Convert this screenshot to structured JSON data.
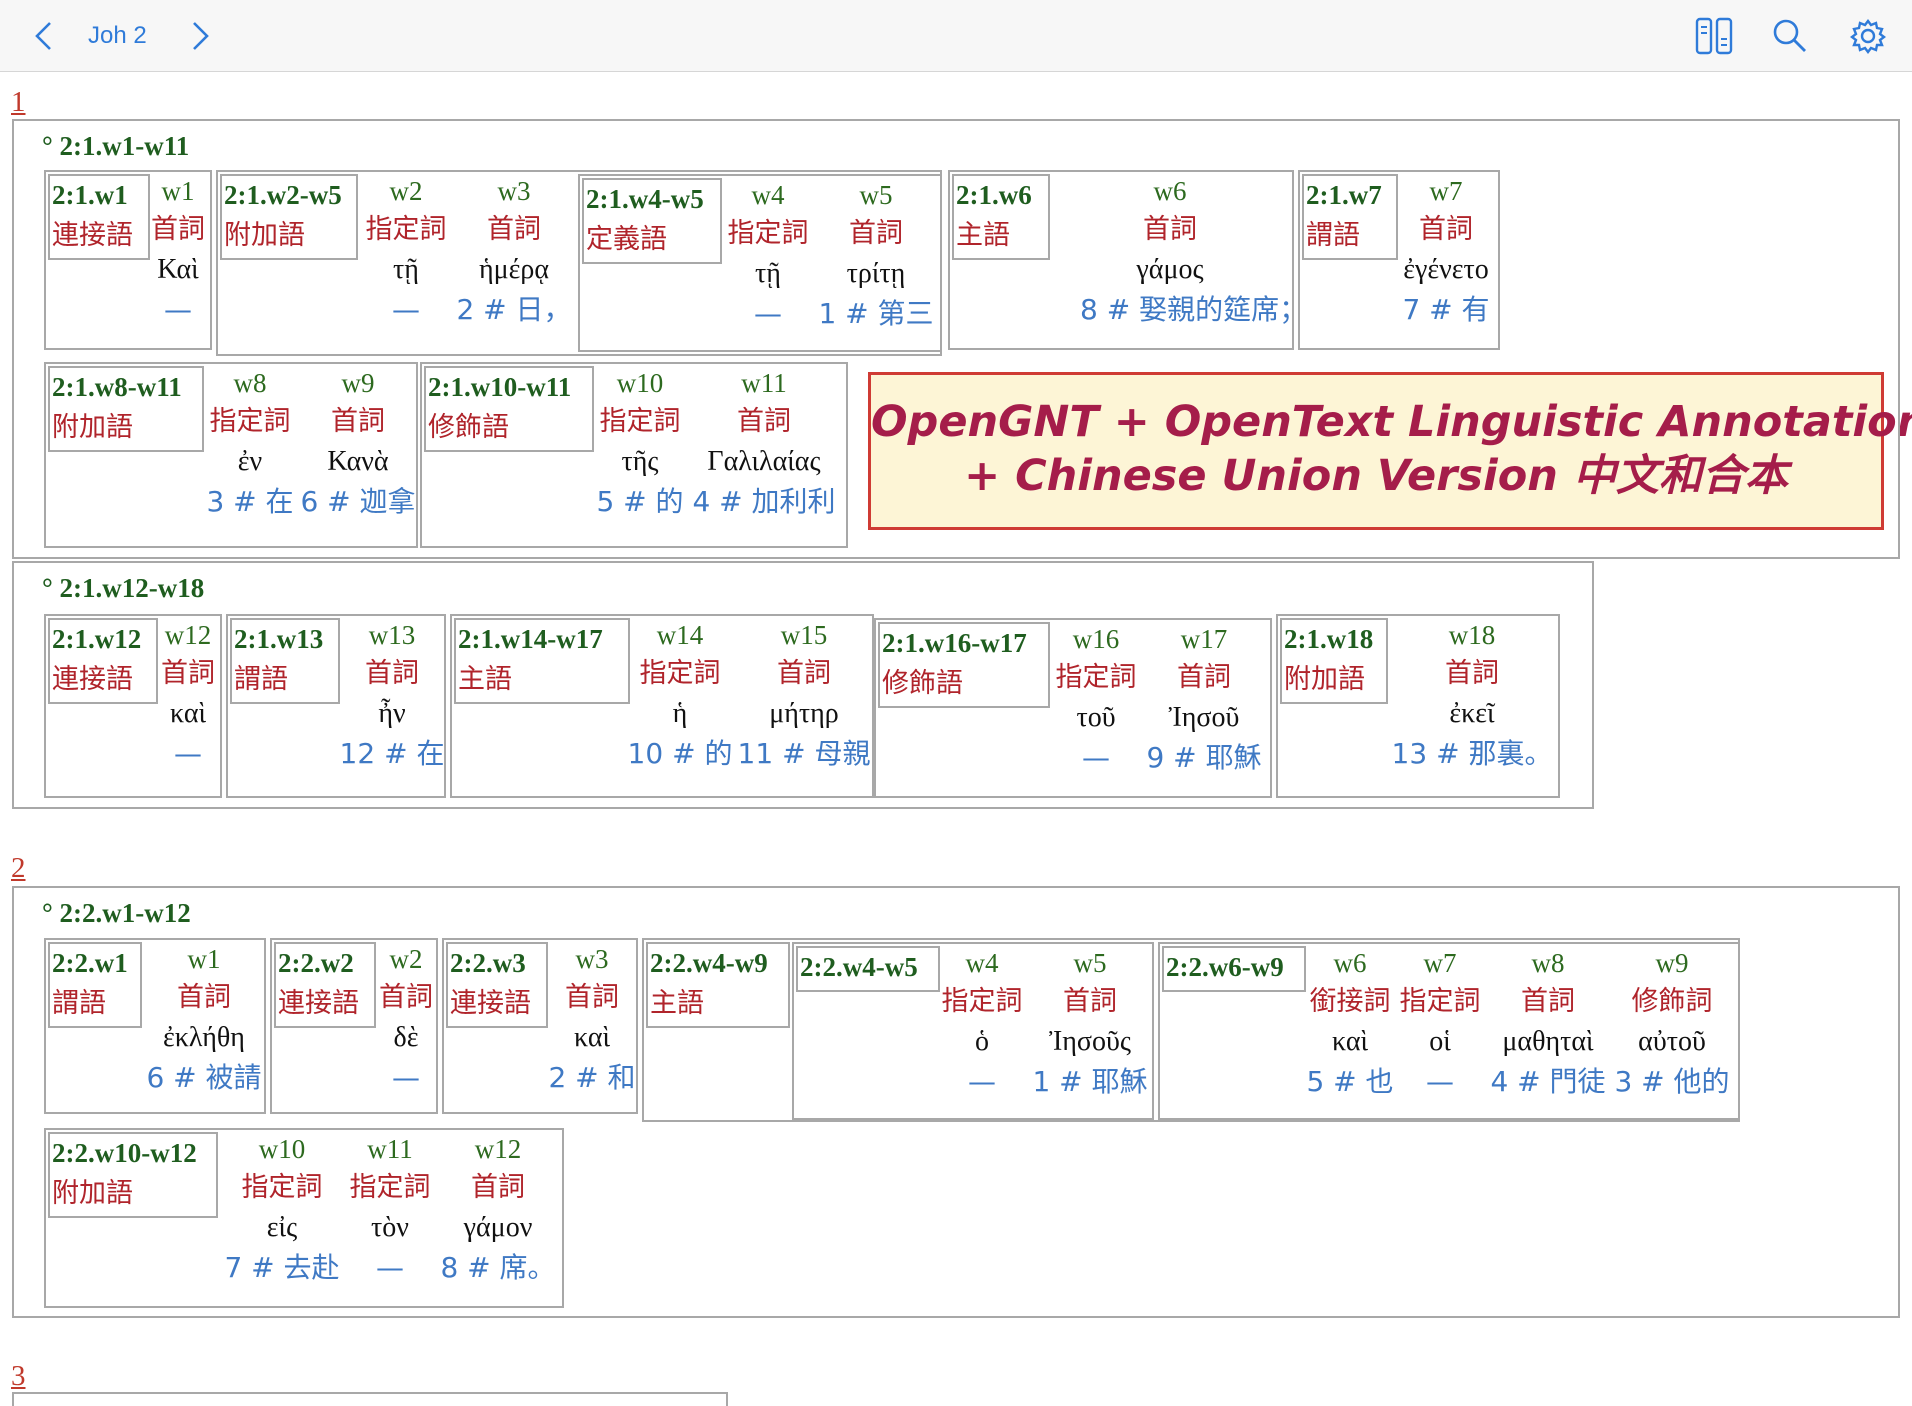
{
  "toolbar": {
    "book": "Joh 2",
    "icons": [
      "chevron-left-icon",
      "chevron-right-icon",
      "parallel-view-icon",
      "search-icon",
      "settings-gear-icon"
    ]
  },
  "banner": {
    "line1": "OpenGNT + OpenText Linguistic Annotations",
    "line2": "+ Chinese Union Version 中文和合本"
  },
  "verses": [
    {
      "number": "1"
    },
    {
      "number": "2"
    },
    {
      "number": "3"
    }
  ],
  "phrases": [
    {
      "label": "° 2:1.w1-w11"
    },
    {
      "label": "° 2:1.w12-w18"
    },
    {
      "label": "° 2:2.w1-w12"
    }
  ],
  "clauses": [
    {
      "label": "2:1.w1",
      "role": "連接語",
      "words": [
        {
          "id": "w1",
          "role": "首詞",
          "greek": "Καὶ",
          "cuv": "—"
        }
      ]
    },
    {
      "label": "2:1.w2-w5",
      "role": "附加語",
      "words": [
        {
          "id": "w2",
          "role": "指定詞",
          "greek": "τῇ",
          "cuv": "—"
        },
        {
          "id": "w3",
          "role": "首詞",
          "greek": "ἡμέρᾳ",
          "cuv": "2 # 日，"
        }
      ]
    },
    {
      "label": "2:1.w4-w5",
      "role": "定義語",
      "words": [
        {
          "id": "w4",
          "role": "指定詞",
          "greek": "τῇ",
          "cuv": "—"
        },
        {
          "id": "w5",
          "role": "首詞",
          "greek": "τρίτῃ",
          "cuv": "1 # 第三"
        }
      ]
    },
    {
      "label": "2:1.w6",
      "role": "主語",
      "words": [
        {
          "id": "w6",
          "role": "首詞",
          "greek": "γάμος",
          "cuv": "8 # 娶親的筵席；"
        }
      ]
    },
    {
      "label": "2:1.w7",
      "role": "謂語",
      "words": [
        {
          "id": "w7",
          "role": "首詞",
          "greek": "ἐγένετο",
          "cuv": "7 # 有"
        }
      ]
    },
    {
      "label": "2:1.w8-w11",
      "role": "附加語",
      "words": [
        {
          "id": "w8",
          "role": "指定詞",
          "greek": "ἐν",
          "cuv": "3 # 在"
        },
        {
          "id": "w9",
          "role": "首詞",
          "greek": "Κανὰ",
          "cuv": "6 # 迦拿"
        }
      ]
    },
    {
      "label": "2:1.w10-w11",
      "role": "修飾語",
      "words": [
        {
          "id": "w10",
          "role": "指定詞",
          "greek": "τῆς",
          "cuv": "5 # 的"
        },
        {
          "id": "w11",
          "role": "首詞",
          "greek": "Γαλιλαίας",
          "cuv": "4 # 加利利"
        }
      ]
    },
    {
      "label": "2:1.w12",
      "role": "連接語",
      "words": [
        {
          "id": "w12",
          "role": "首詞",
          "greek": "καὶ",
          "cuv": "—"
        }
      ]
    },
    {
      "label": "2:1.w13",
      "role": "謂語",
      "words": [
        {
          "id": "w13",
          "role": "首詞",
          "greek": "ἦν",
          "cuv": "12 # 在"
        }
      ]
    },
    {
      "label": "2:1.w14-w17",
      "role": "主語",
      "words": [
        {
          "id": "w14",
          "role": "指定詞",
          "greek": "ἡ",
          "cuv": "10 # 的"
        },
        {
          "id": "w15",
          "role": "首詞",
          "greek": "μήτηρ",
          "cuv": "11 # 母親"
        }
      ]
    },
    {
      "label": "2:1.w16-w17",
      "role": "修飾語",
      "words": [
        {
          "id": "w16",
          "role": "指定詞",
          "greek": "τοῦ",
          "cuv": "—"
        },
        {
          "id": "w17",
          "role": "首詞",
          "greek": "Ἰησοῦ",
          "cuv": "9 # 耶穌"
        }
      ]
    },
    {
      "label": "2:1.w18",
      "role": "附加語",
      "words": [
        {
          "id": "w18",
          "role": "首詞",
          "greek": "ἐκεῖ",
          "cuv": "13 # 那裏。"
        }
      ]
    },
    {
      "label": "2:2.w1",
      "role": "謂語",
      "words": [
        {
          "id": "w1",
          "role": "首詞",
          "greek": "ἐκλήθη",
          "cuv": "6 # 被請"
        }
      ]
    },
    {
      "label": "2:2.w2",
      "role": "連接語",
      "words": [
        {
          "id": "w2",
          "role": "首詞",
          "greek": "δὲ",
          "cuv": "—"
        }
      ]
    },
    {
      "label": "2:2.w3",
      "role": "連接語",
      "words": [
        {
          "id": "w3",
          "role": "首詞",
          "greek": "καὶ",
          "cuv": "2 # 和"
        }
      ]
    },
    {
      "label": "2:2.w4-w9",
      "role": "主語",
      "words": []
    },
    {
      "label": "2:2.w4-w5",
      "role": "",
      "words": [
        {
          "id": "w4",
          "role": "指定詞",
          "greek": "ὁ",
          "cuv": "—"
        },
        {
          "id": "w5",
          "role": "首詞",
          "greek": "Ἰησοῦς",
          "cuv": "1 # 耶穌"
        }
      ]
    },
    {
      "label": "2:2.w6-w9",
      "role": "",
      "words": [
        {
          "id": "w6",
          "role": "銜接詞",
          "greek": "καὶ",
          "cuv": "5 # 也"
        },
        {
          "id": "w7",
          "role": "指定詞",
          "greek": "οἱ",
          "cuv": "—"
        },
        {
          "id": "w8",
          "role": "首詞",
          "greek": "μαθηταὶ",
          "cuv": "4 # 門徒"
        },
        {
          "id": "w9",
          "role": "修飾詞",
          "greek": "αὐτοῦ",
          "cuv": "3 # 他的"
        }
      ]
    },
    {
      "label": "2:2.w10-w12",
      "role": "附加語",
      "words": [
        {
          "id": "w10",
          "role": "指定詞",
          "greek": "εἰς",
          "cuv": "7 # 去赴"
        },
        {
          "id": "w11",
          "role": "指定詞",
          "greek": "τὸν",
          "cuv": "—"
        },
        {
          "id": "w12",
          "role": "首詞",
          "greek": "γάμον",
          "cuv": "8 # 席。"
        }
      ]
    }
  ]
}
